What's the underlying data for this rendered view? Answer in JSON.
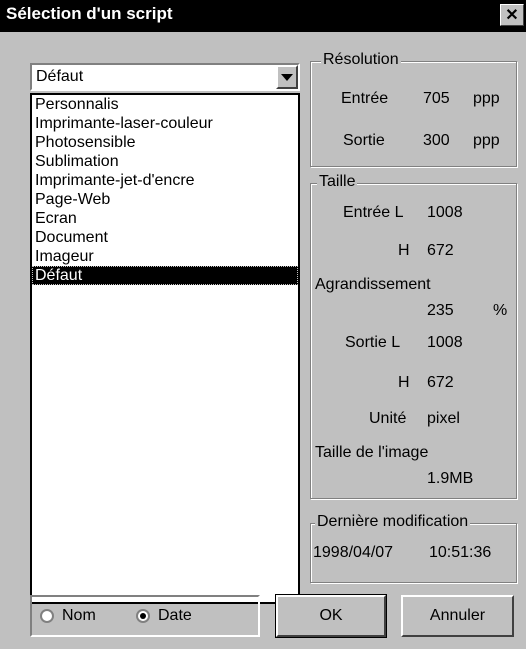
{
  "window": {
    "title": "Sélection d'un script",
    "close_label": "✕"
  },
  "script_select": {
    "value": "Défaut",
    "items": [
      "Personnalis",
      "Imprimante-laser-couleur",
      "Photosensible",
      "Sublimation",
      "Imprimante-jet-d'encre",
      "Page-Web",
      "Ecran",
      "Document",
      "Imageur",
      "Défaut"
    ],
    "selected_index": 9
  },
  "resolution": {
    "legend": "Résolution",
    "input_label": "Entrée",
    "input_value": "705",
    "input_unit": "ppp",
    "output_label": "Sortie",
    "output_value": "300",
    "output_unit": "ppp"
  },
  "size": {
    "legend": "Taille",
    "input_w_label": "Entrée L",
    "input_w": "1008",
    "input_h_label": "H",
    "input_h": "672",
    "zoom_label": "Agrandissement",
    "zoom_value": "235",
    "zoom_unit": "%",
    "output_w_label": "Sortie L",
    "output_w": "1008",
    "output_h_label": "H",
    "output_h": "672",
    "unit_label": "Unité",
    "unit_value": "pixel",
    "image_size_label": "Taille de l'image",
    "image_size_value": "1.9MB"
  },
  "last_modified": {
    "legend": "Dernière modification",
    "date": "1998/04/07",
    "time": "10:51:36"
  },
  "sort": {
    "name_label": "Nom",
    "date_label": "Date",
    "selected": "date"
  },
  "buttons": {
    "ok": "OK",
    "cancel": "Annuler"
  }
}
